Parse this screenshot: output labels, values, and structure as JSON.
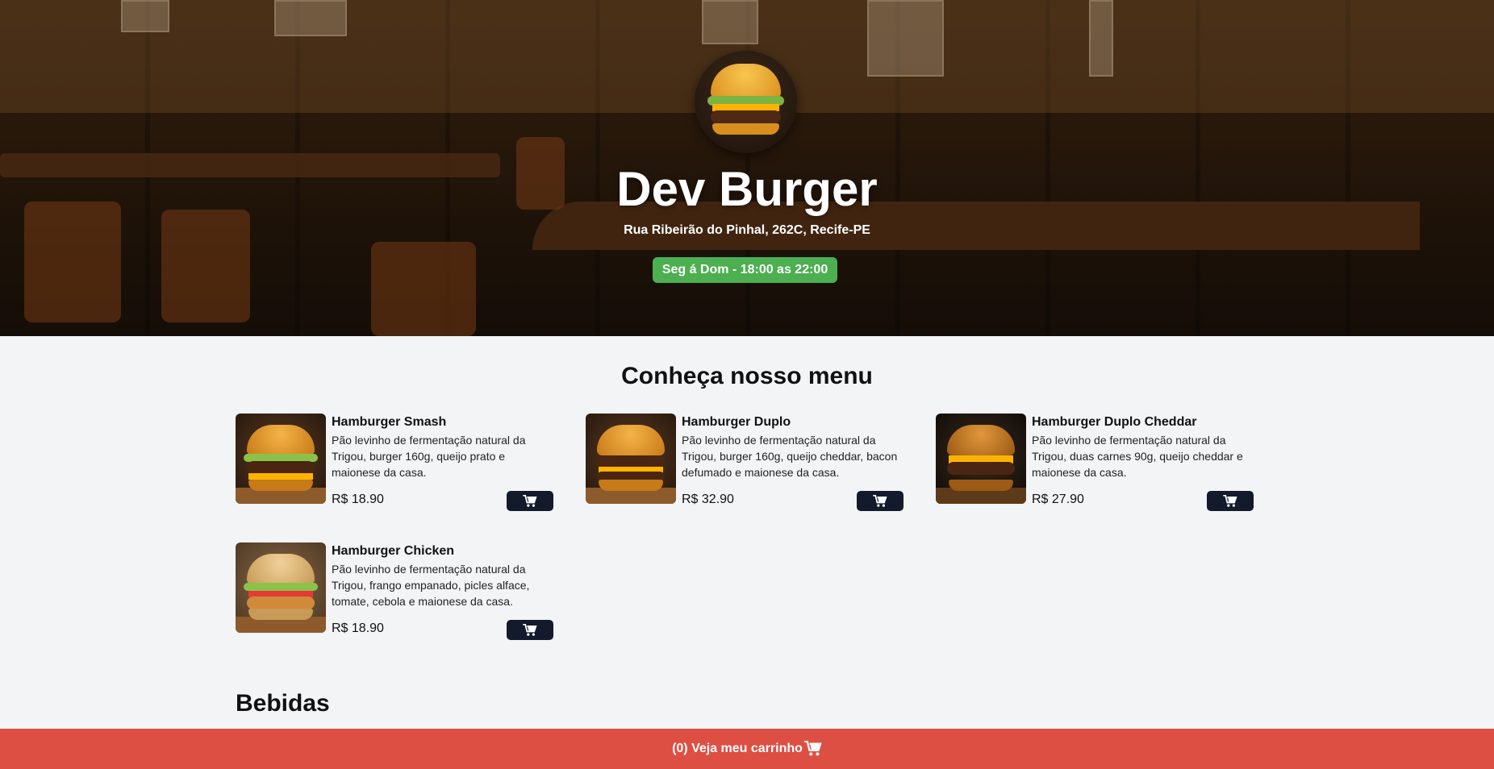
{
  "hero": {
    "title": "Dev Burger",
    "address": "Rua Ribeirão do Pinhal, 262C, Recife-PE",
    "hours": "Seg á Dom - 18:00 as 22:00"
  },
  "menu": {
    "title": "Conheça nosso menu",
    "items": [
      {
        "name": "Hamburger Smash",
        "description": "Pão levinho de fermentação natural da Trigou, burger 160g, queijo prato e maionese da casa.",
        "price": "R$ 18.90"
      },
      {
        "name": "Hamburger Duplo",
        "description": "Pão levinho de fermentação natural da Trigou, burger 160g, queijo cheddar, bacon defumado e maionese da casa.",
        "price": "R$ 32.90"
      },
      {
        "name": "Hamburger Duplo Cheddar",
        "description": "Pão levinho de fermentação natural da Trigou, duas carnes 90g, queijo cheddar e maionese da casa.",
        "price": "R$ 27.90"
      },
      {
        "name": "Hamburger Chicken",
        "description": "Pão levinho de fermentação natural da Trigou, frango empanado, picles alface, tomate, cebola e maionese da casa.",
        "price": "R$ 18.90"
      }
    ]
  },
  "drinks": {
    "title": "Bebidas"
  },
  "cart": {
    "label": "(0) Veja meu carrinho"
  },
  "colors": {
    "accent_green": "#4caf50",
    "cart_bar": "#de4f43",
    "button_dark": "#121a2b"
  },
  "icons": {
    "cart": "cart-icon",
    "logo": "burger-logo"
  }
}
